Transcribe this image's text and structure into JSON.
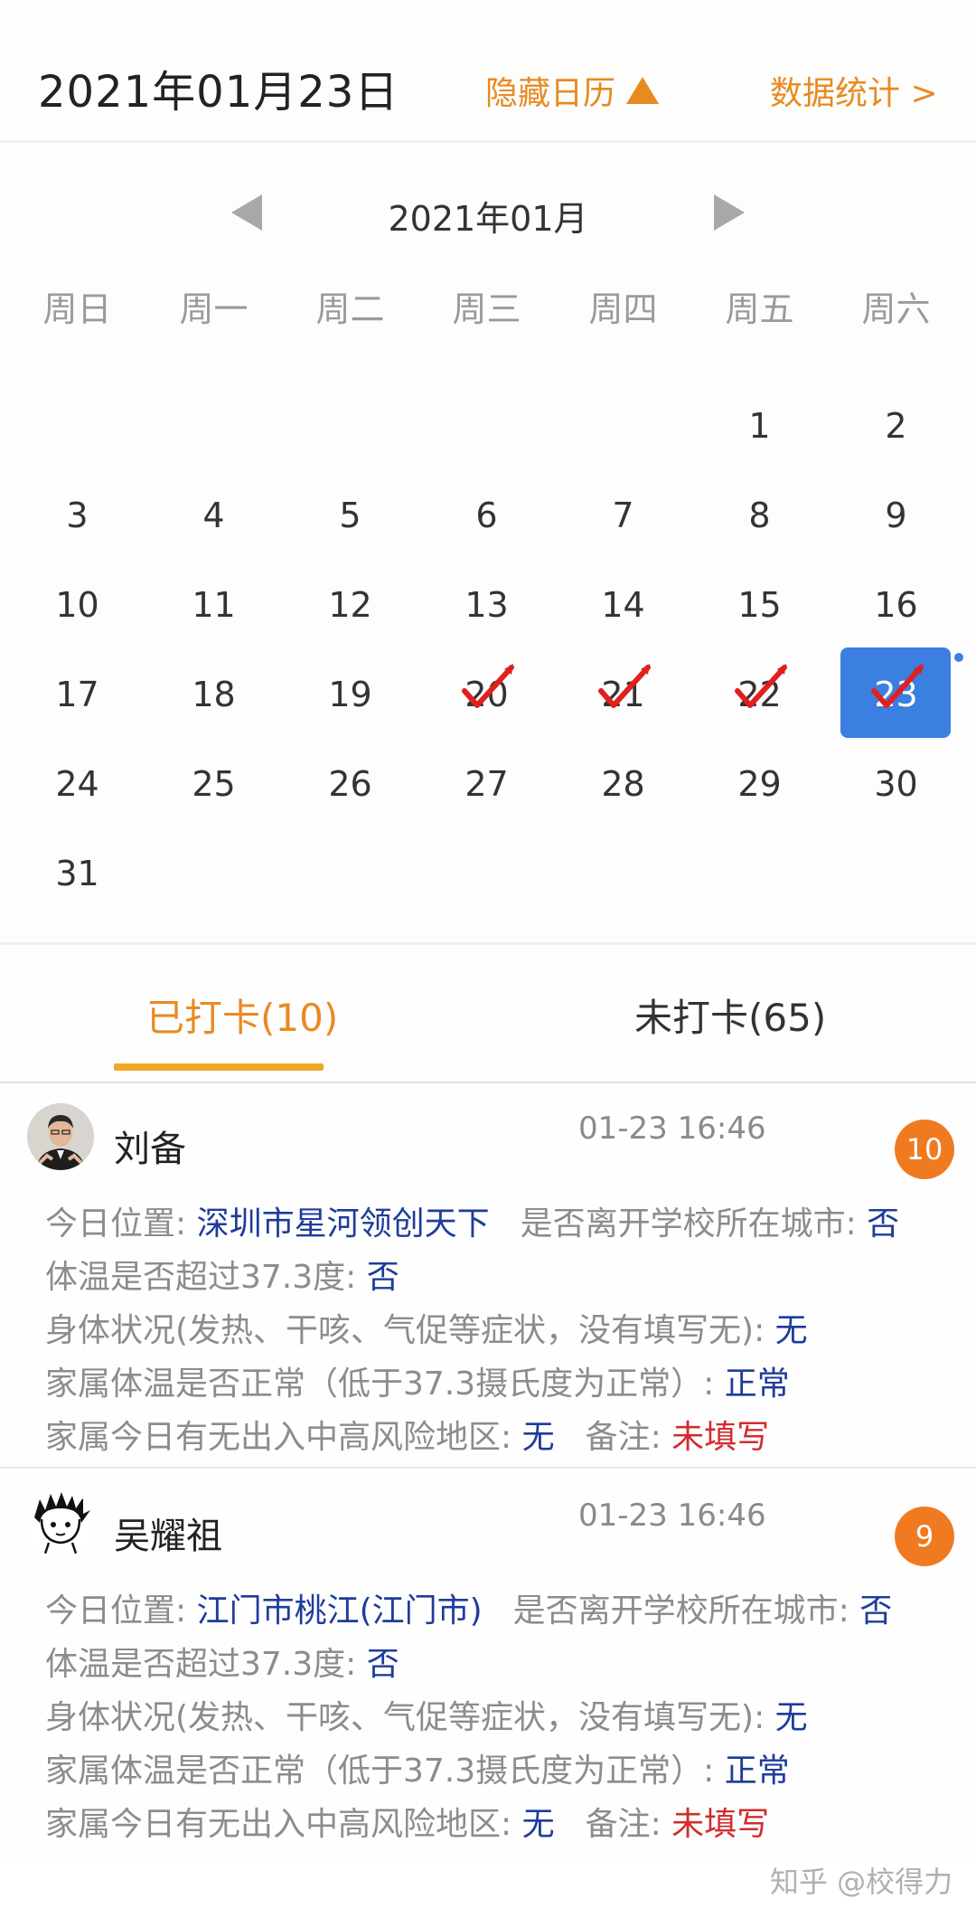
{
  "header": {
    "date": "2021年01月23日",
    "hide_calendar_label": "隐藏日历",
    "stats_label": "数据统计 >"
  },
  "calendar": {
    "month_title": "2021年01月",
    "weekdays": [
      "周日",
      "周一",
      "周二",
      "周三",
      "周四",
      "周五",
      "周六"
    ],
    "days": [
      "",
      "",
      "",
      "",
      "",
      "1",
      "2",
      "3",
      "4",
      "5",
      "6",
      "7",
      "8",
      "9",
      "10",
      "11",
      "12",
      "13",
      "14",
      "15",
      "16",
      "17",
      "18",
      "19",
      "20",
      "21",
      "22",
      "23",
      "24",
      "25",
      "26",
      "27",
      "28",
      "29",
      "30",
      "31"
    ],
    "checked_days": [
      "20",
      "21",
      "22",
      "23"
    ],
    "selected_day": "23",
    "colors": {
      "selected": "#3b7fe0",
      "check": "#e02020",
      "arrow": "#a8a8a8"
    }
  },
  "tabs": {
    "checked_label": "已打卡(10)",
    "unchecked_label": "未打卡(65)",
    "active": "checked",
    "accent": "#e88a22"
  },
  "records": [
    {
      "name": "刘备",
      "time": "01-23 16:46",
      "badge": "10",
      "location_label": "今日位置: ",
      "location_value": "深圳市星河领创天下",
      "left_city_label": "是否离开学校所在城市: ",
      "left_city_value": "否",
      "temp_label": "体温是否超过37.3度: ",
      "temp_value": "否",
      "health_label": "身体状况(发热、干咳、气促等症状，没有填写无): ",
      "health_value": "无",
      "family_temp_label": "家属体温是否正常（低于37.3摄氏度为正常）: ",
      "family_temp_value": "正常",
      "family_risk_label": "家属今日有无出入中高风险地区: ",
      "family_risk_value": "无",
      "remark_label": "备注: ",
      "remark_value": "未填写"
    },
    {
      "name": "吴耀祖",
      "time": "01-23 16:46",
      "badge": "9",
      "location_label": "今日位置: ",
      "location_value": "江门市桃江(江门市)",
      "left_city_label": "是否离开学校所在城市: ",
      "left_city_value": "否",
      "temp_label": "体温是否超过37.3度: ",
      "temp_value": "否",
      "health_label": "身体状况(发热、干咳、气促等症状，没有填写无): ",
      "health_value": "无",
      "family_temp_label": "家属体温是否正常（低于37.3摄氏度为正常）: ",
      "family_temp_value": "正常",
      "family_risk_label": "家属今日有无出入中高风险地区: ",
      "family_risk_value": "无",
      "remark_label": "备注: ",
      "remark_value": "未填写"
    }
  ],
  "watermark": "知乎 @校得力",
  "icons": {
    "hide_calendar": "triangle-up-icon",
    "prev_month": "triangle-left-icon",
    "next_month": "triangle-right-icon",
    "check": "check-mark-icon"
  }
}
